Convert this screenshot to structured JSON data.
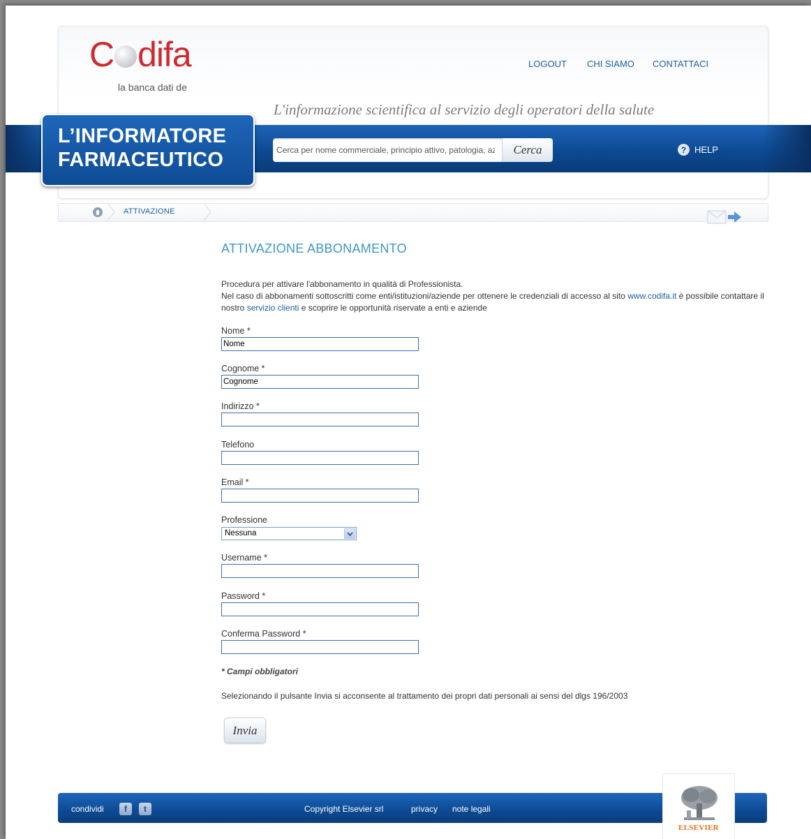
{
  "header": {
    "logo_text_pre": "C",
    "logo_text_post": "difa",
    "logo_tagline": "la banca dati de",
    "nav": [
      "LOGOUT",
      "CHI SIAMO",
      "CONTATTACI"
    ],
    "slogan": "L'informazione scientifica al servizio degli operatori della salute",
    "brand_line1": "L’INFORMATORE",
    "brand_line2": "FARMACEUTICO",
    "search_placeholder": "Cerca per nome commerciale, principio attivo, patologia, az",
    "search_button": "Cerca",
    "help": "HELP"
  },
  "breadcrumb": {
    "current": "ATTIVAZIONE"
  },
  "main": {
    "title": "ATTIVAZIONE ABBONAMENTO",
    "intro_line1": "Procedura per attivare l'abbonamento in qualità di Professionista.",
    "intro_line2_a": "Nel caso di abbonamenti sottoscritti come enti/istituzioni/aziende per ottenere le credenziali di accesso al sito ",
    "intro_link_site": "www.codifa.it",
    "intro_line2_b": " è possibile contattare il nostro ",
    "intro_link_service": "servizio clienti",
    "intro_line2_c": " e scoprire le opportunità riservate a enti e aziende"
  },
  "form": {
    "nome_label": "Nome *",
    "nome_value": "Nome",
    "cognome_label": "Cognome *",
    "cognome_value": "Cognome",
    "indirizzo_label": "Indirizzo *",
    "indirizzo_value": "",
    "telefono_label": "Telefono",
    "telefono_value": "",
    "email_label": "Email *",
    "email_value": "",
    "professione_label": "Professione",
    "professione_value": "Nessuna",
    "username_label": "Username *",
    "username_value": "",
    "password_label": "Password *",
    "password_value": "",
    "conferma_label": "Conferma Password *",
    "conferma_value": "",
    "required_note": "* Campi obbligatori",
    "consent": "Selezionando il pulsante Invia si acconsente al trattamento dei propri dati personali ai sensi del dlgs 196/2003",
    "submit": "Invia"
  },
  "footer": {
    "share": "condividi",
    "facebook_glyph": "f",
    "twitter_glyph": "t",
    "copyright": "Copyright Elsevier srl",
    "privacy": "privacy",
    "legal": "note legali",
    "publisher": "ELSEVIER"
  },
  "colors": {
    "brand_red": "#d0282e",
    "band_blue": "#0d4a93",
    "link_blue": "#1a5fa8",
    "title_blue": "#3d95c9",
    "elsevier_orange": "#e86b13"
  }
}
